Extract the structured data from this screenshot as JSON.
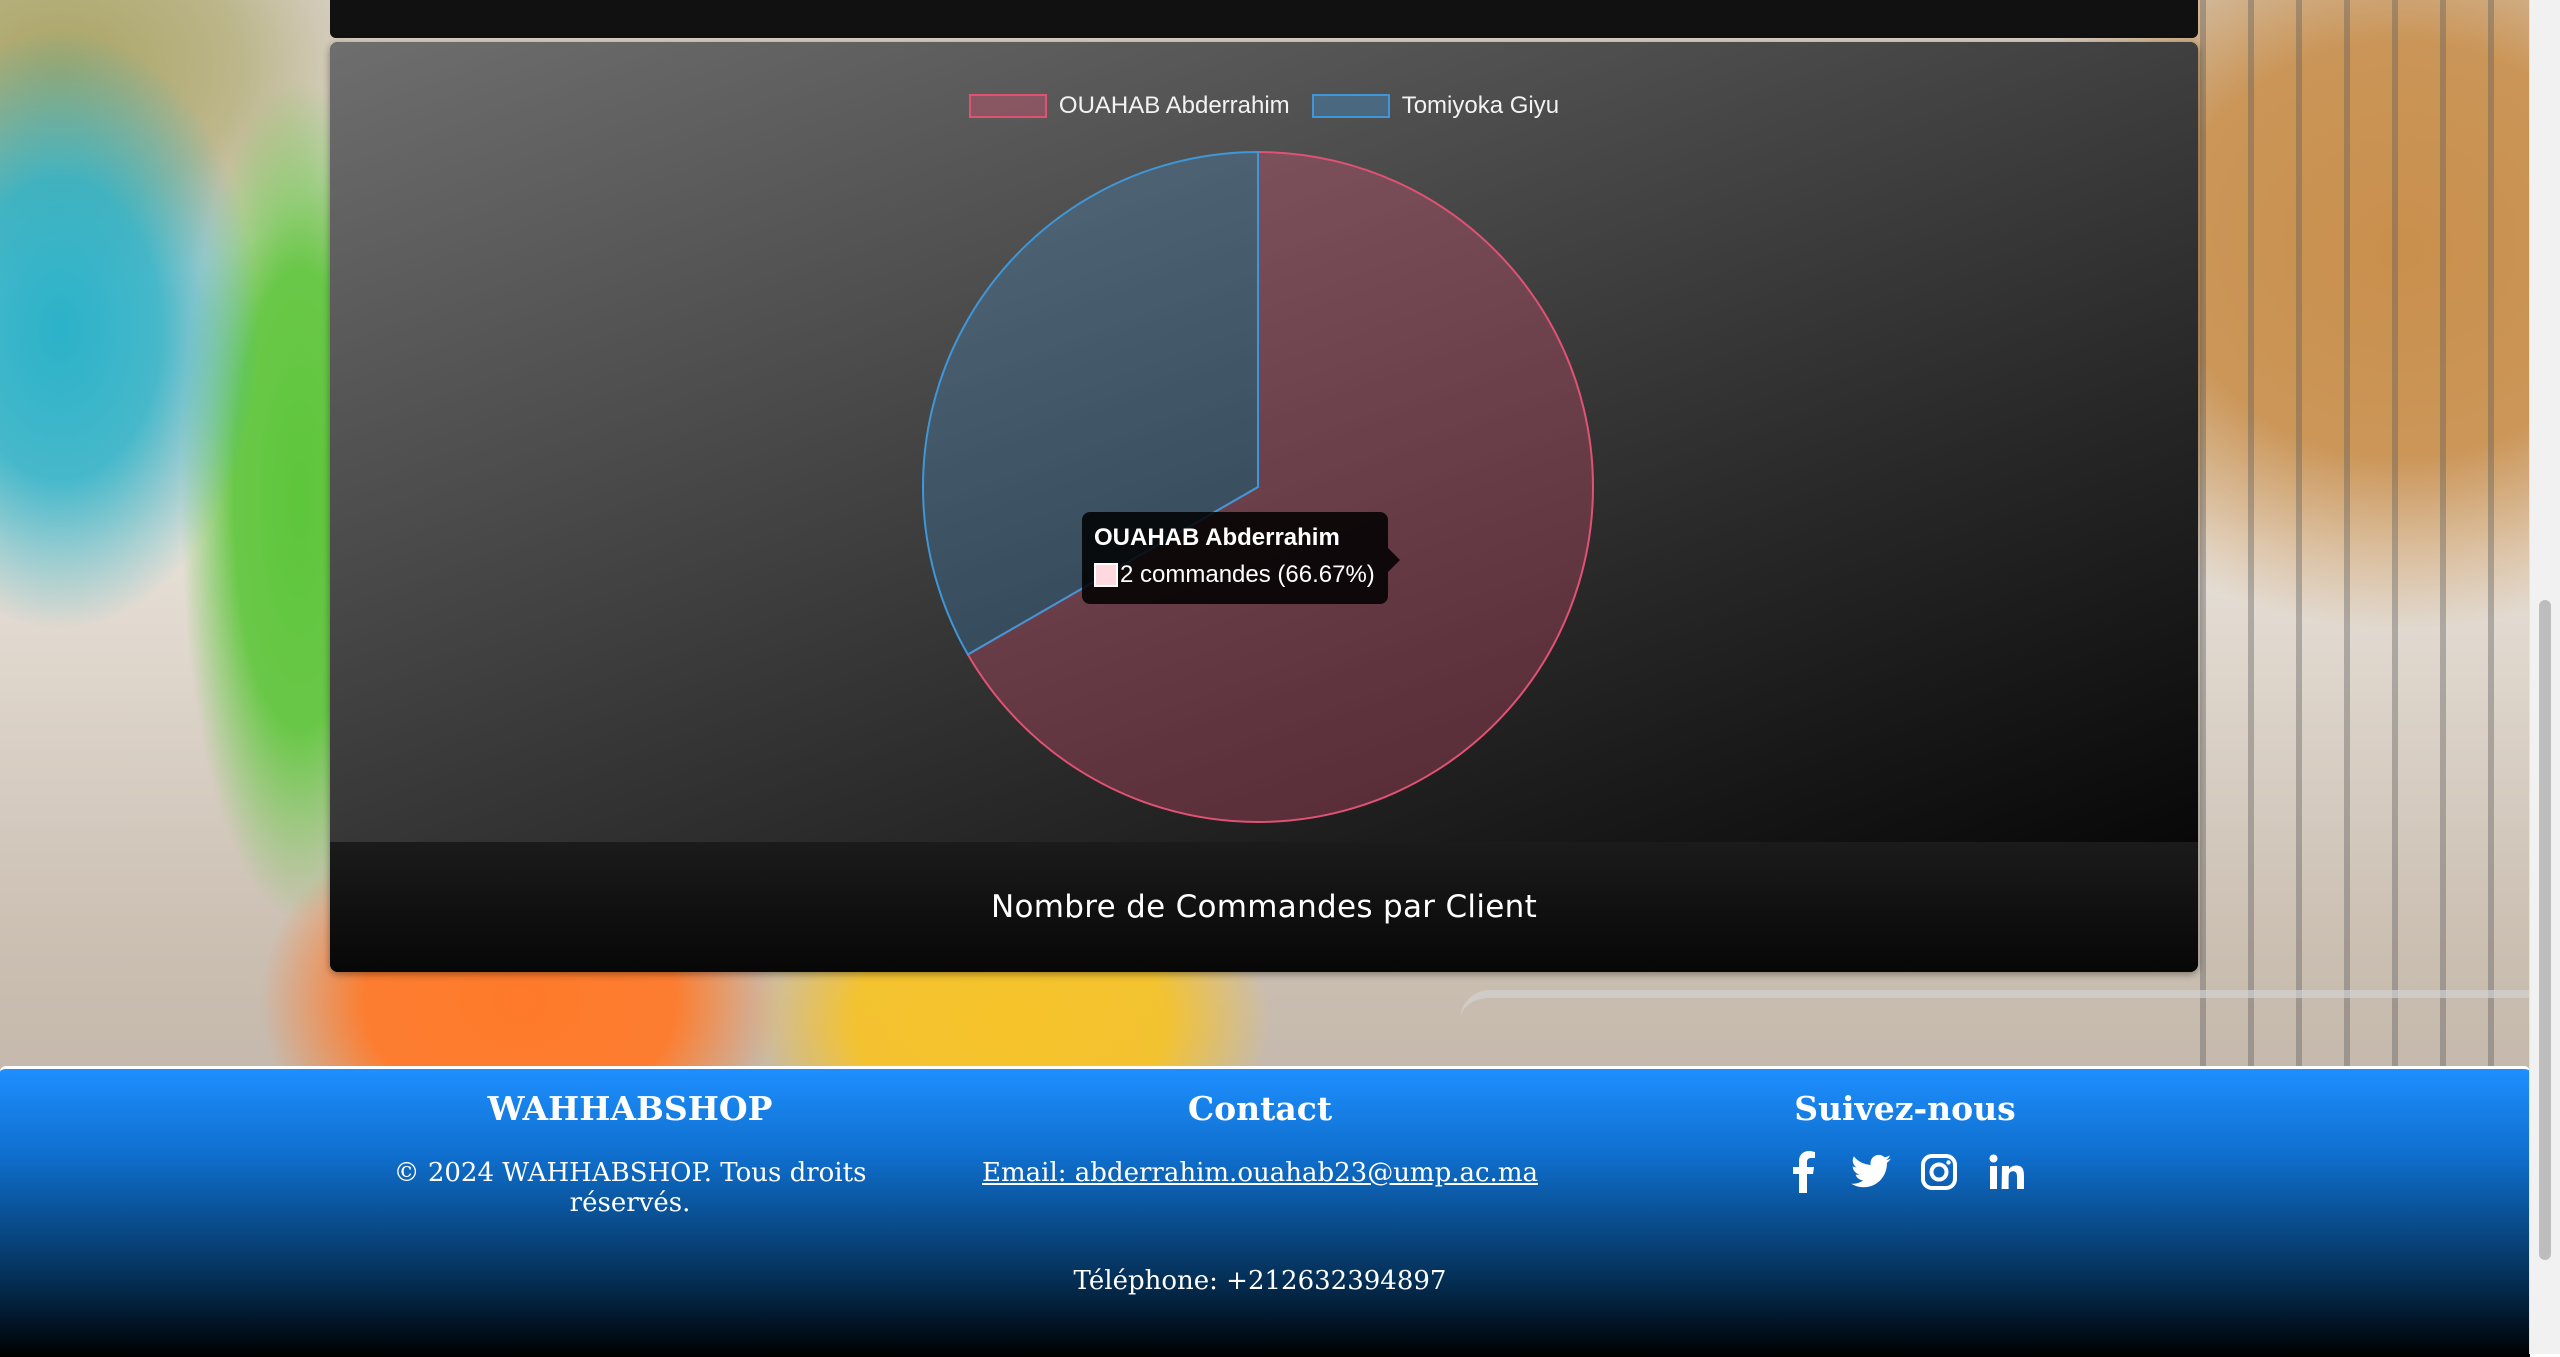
{
  "chart": {
    "legend": [
      {
        "label": "OUAHAB Abderrahim",
        "border": "#e05274",
        "fill": "#8a5260"
      },
      {
        "label": "Tomiyoka Giyu",
        "border": "#3f96d8",
        "fill": "#4d6475"
      }
    ],
    "caption": "Nombre de Commandes par Client",
    "tooltip": {
      "title": "OUAHAB Abderrahim",
      "line": "2 commandes (66.67%)"
    }
  },
  "chart_data": {
    "type": "pie",
    "categories": [
      "OUAHAB Abderrahim",
      "Tomiyoka Giyu"
    ],
    "values": [
      2,
      1
    ],
    "title": "Nombre de Commandes par Client",
    "legend": "top",
    "colors": [
      "#e05274",
      "#3f96d8"
    ]
  },
  "footer": {
    "brand": {
      "title": "WAHHABSHOP",
      "copyright": "© 2024 WAHHABSHOP. Tous droits réservés."
    },
    "contact": {
      "title": "Contact",
      "email": "Email: abderrahim.ouahab23@ump.ac.ma",
      "phone": "Téléphone: +212632394897"
    },
    "social": {
      "title": "Suivez-nous",
      "icons": [
        "facebook-icon",
        "twitter-icon",
        "instagram-icon",
        "linkedin-icon"
      ]
    }
  }
}
